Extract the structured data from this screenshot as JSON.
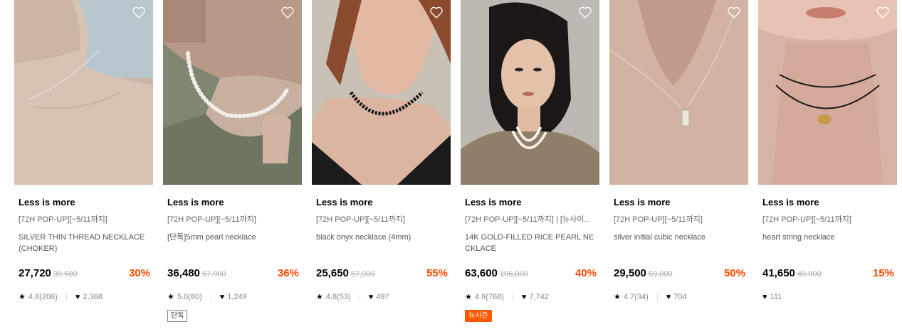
{
  "products": [
    {
      "brand": "Less is more",
      "promo": "[72H POP-UP][~5/11까지]",
      "name": "SILVER THIN THREAD NECKLACE (CHOKER)",
      "price": "27,720",
      "original_price": "39,600",
      "discount": "30%",
      "rating": "4.8(206)",
      "likes": "2,368",
      "tag": "",
      "image_alt": "model wearing thin silver thread choker"
    },
    {
      "brand": "Less is more",
      "promo": "[72H POP-UP][~5/11까지]",
      "name": "[단독]5mm pearl necklace",
      "price": "36,480",
      "original_price": "57,000",
      "discount": "36%",
      "rating": "5.0(80)",
      "likes": "1,249",
      "tag": "단독",
      "image_alt": "model wearing pearl necklace with green knit"
    },
    {
      "brand": "Less is more",
      "promo": "[72H POP-UP][~5/11까지]",
      "name": "black onyx necklace (4mm)",
      "price": "25,650",
      "original_price": "57,000",
      "discount": "55%",
      "rating": "4.8(53)",
      "likes": "497",
      "tag": "",
      "image_alt": "model wearing black onyx bead necklace"
    },
    {
      "brand": "Less is more",
      "promo": "[72H POP-UP][~5/11까지] | [뉴사이...",
      "name": "14K GOLD-FILLED RICE PEARL NECKLACE",
      "price": "63,600",
      "original_price": "106,000",
      "discount": "40%",
      "rating": "4.9(768)",
      "likes": "7,742",
      "tag": "뉴시즌",
      "image_alt": "model wearing layered rice pearl necklace"
    },
    {
      "brand": "Less is more",
      "promo": "[72H POP-UP][~5/11까지]",
      "name": "silver initial cubic necklace",
      "price": "29,500",
      "original_price": "59,000",
      "discount": "50%",
      "rating": "4.7(34)",
      "likes": "704",
      "tag": "",
      "image_alt": "close-up of silver initial cubic pendant"
    },
    {
      "brand": "Less is more",
      "promo": "[72H POP-UP][~5/11까지]",
      "name": "heart string necklace",
      "price": "41,650",
      "original_price": "49,000",
      "discount": "15%",
      "rating": "",
      "likes": "111",
      "tag": "",
      "image_alt": "model wearing black string necklace with gold heart"
    }
  ],
  "colors": {
    "discount": "#ff4800",
    "new_season_tag": "#ff5a00"
  },
  "icons": {
    "wishlist": "heart-outline-icon",
    "rating": "star-icon",
    "likes": "heart-filled-icon"
  }
}
